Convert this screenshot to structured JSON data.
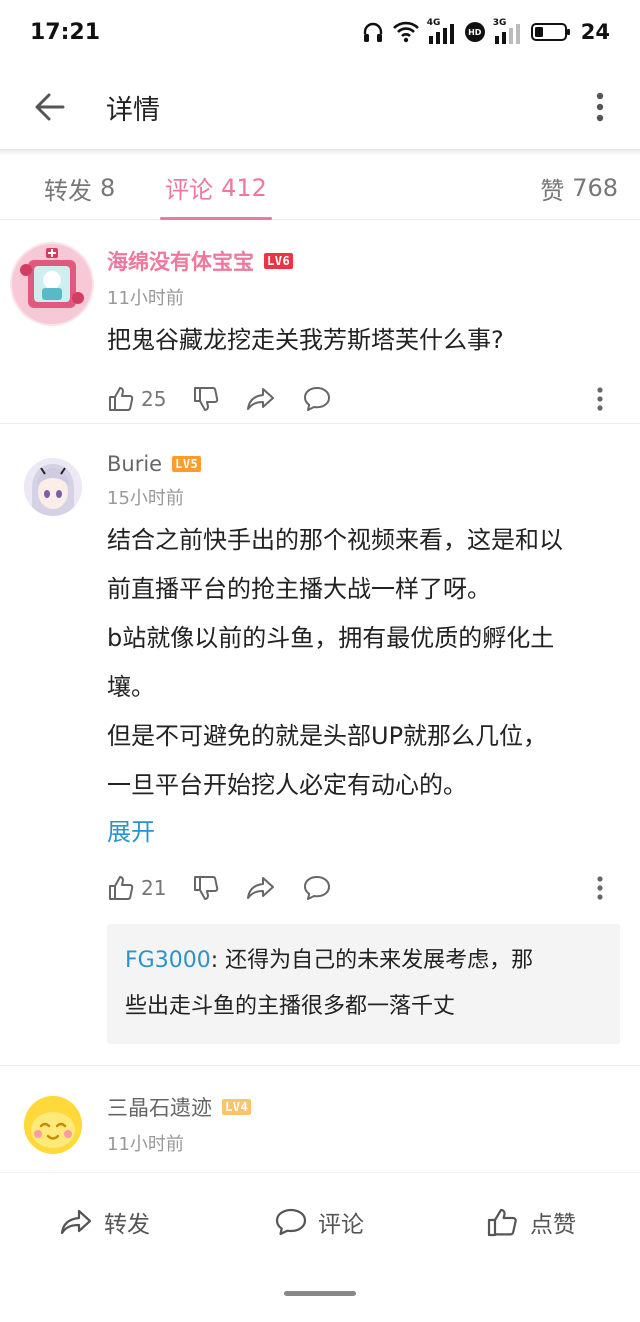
{
  "status_bar": {
    "time": "17:21",
    "net_label_1": "4G",
    "net_label_2": "3G",
    "hd_label": "HD",
    "battery": "24"
  },
  "app_bar": {
    "title": "详情",
    "icons": [
      "arrow-left-icon",
      "more-vertical-icon"
    ]
  },
  "tabs": {
    "repost": {
      "label": "转发",
      "count": "8"
    },
    "comment": {
      "label": "评论",
      "count": "412",
      "active": true,
      "color": "#f0789c"
    },
    "like": {
      "label": "赞",
      "count": "768"
    }
  },
  "comments": [
    {
      "username": "海绵没有体宝宝",
      "level": "LV6",
      "timestamp": "11小时前",
      "lines": [
        "把鬼谷藏龙挖走关我芳斯塔芙什么事?"
      ],
      "like_count": "25"
    },
    {
      "username": "Burie",
      "level": "LV5",
      "timestamp": "15小时前",
      "lines": [
        "结合之前快手出的那个视频来看，这是和以",
        "前直播平台的抢主播大战一样了呀。",
        "b站就像以前的斗鱼，拥有最优质的孵化土",
        "壤。",
        "但是不可避免的就是头部UP就那么几位，",
        "一旦平台开始挖人必定有动心的。"
      ],
      "expand_label": "展开",
      "like_count": "21",
      "reply": {
        "user": "FG3000",
        "separator": ":",
        "text_line1": " 还得为自己的未来发展考虑，那",
        "text_line2": "些出走斗鱼的主播很多都一落千丈"
      }
    },
    {
      "username": "三晶石遗迹",
      "level": "LV4",
      "timestamp": "11小时前"
    }
  ],
  "bottom_bar": {
    "repost_label": "转发",
    "comment_label": "评论",
    "like_label": "点赞"
  },
  "colors": {
    "accent_pink": "#f0789c",
    "link_blue": "#2b92cc",
    "lv6": "#ee3344",
    "lv5": "#ff9c2a",
    "lv4": "#ffc36e"
  }
}
